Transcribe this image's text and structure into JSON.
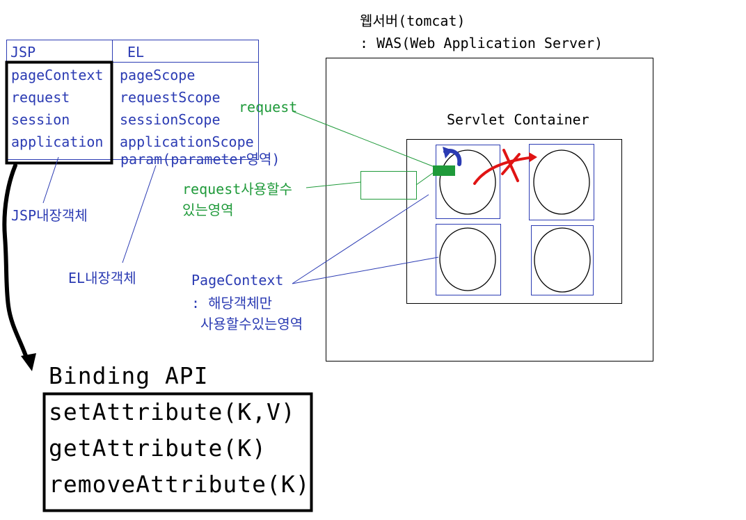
{
  "server": {
    "title_line1": "웹서버(tomcat)",
    "title_line2": ": WAS(Web Application Server)",
    "container_label": "Servlet Container"
  },
  "table": {
    "headers": [
      "JSP",
      "EL"
    ],
    "jsp_objects": [
      "pageContext",
      "request",
      "session",
      "application"
    ],
    "el_objects": [
      "pageScope",
      "requestScope",
      "sessionScope",
      "applicationScope"
    ],
    "el_extra": "param(parameter영역)"
  },
  "annotations": {
    "jsp_builtin": "JSP내장객체",
    "el_builtin": "EL내장객체",
    "request_label": "request",
    "request_area_line1": "request사용할수",
    "request_area_line2": "있는영역",
    "pagecontext_line1": "PageContext",
    "pagecontext_line2": ": 해당객체만",
    "pagecontext_line3": "사용할수있는영역"
  },
  "binding": {
    "title": "Binding API",
    "methods": [
      "setAttribute(K,V)",
      "getAttribute(K)",
      "removeAttribute(K)"
    ]
  },
  "colors": {
    "blue": "#2b3bb3",
    "green": "#1f9a3a",
    "red": "#e01414",
    "black": "#000000"
  }
}
